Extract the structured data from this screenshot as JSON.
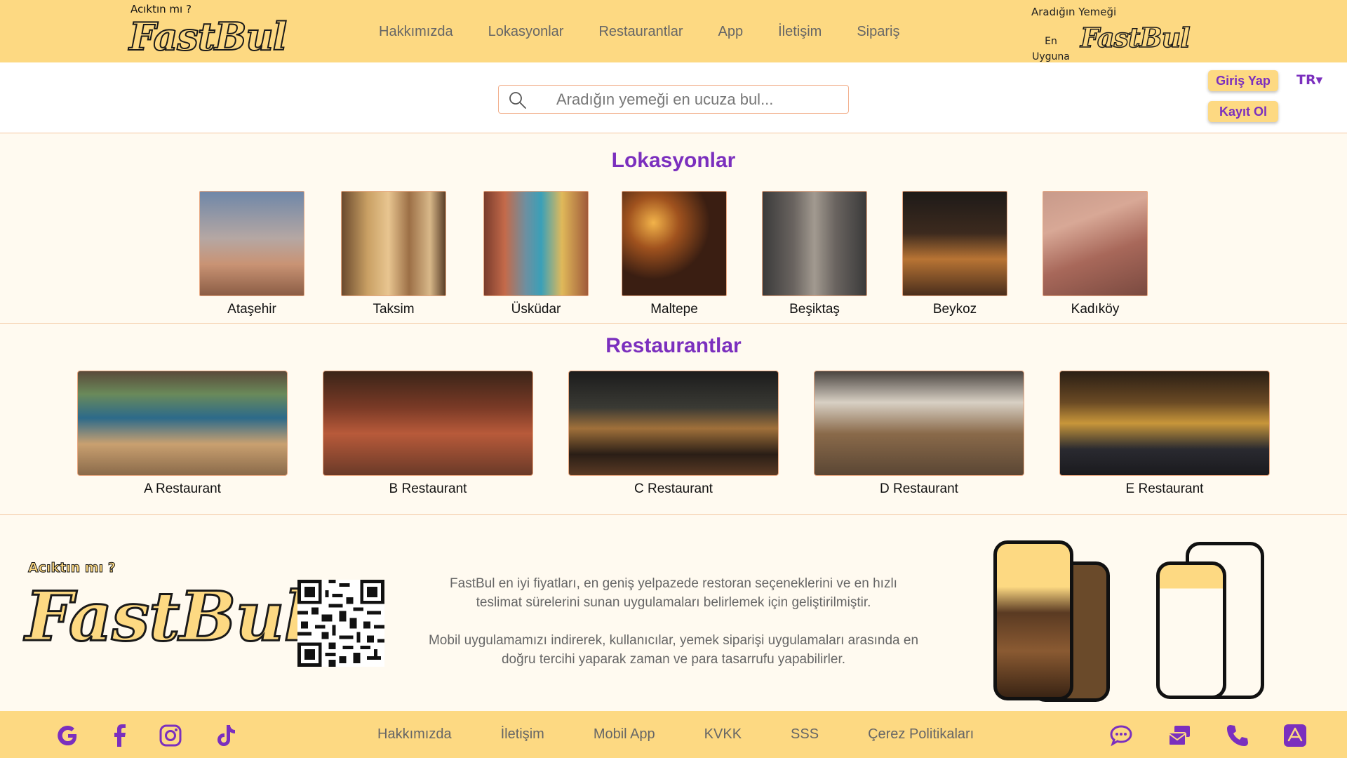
{
  "header": {
    "tagline": "Acıktın mı ?",
    "logo": "FastBul",
    "nav": [
      "Hakkımızda",
      "Lokasyonlar",
      "Restaurantlar",
      "App",
      "İletişim",
      "Sipariş"
    ],
    "slogan_top": "Aradığın Yemeği",
    "slogan_left_1": "En",
    "slogan_left_2": "Uyguna",
    "logo_small": "FastBul"
  },
  "search": {
    "placeholder": "Aradığın yemeği en ucuza bul..."
  },
  "auth": {
    "login": "Giriş Yap",
    "signup": "Kayıt Ol",
    "lang": "TR▾"
  },
  "locations": {
    "title": "Lokasyonlar",
    "items": [
      "Ataşehir",
      "Taksim",
      "Üsküdar",
      "Maltepe",
      "Beşiktaş",
      "Beykoz",
      "Kadıköy"
    ]
  },
  "restaurants": {
    "title": "Restaurantlar",
    "items": [
      "A Restaurant",
      "B Restaurant",
      "C Restaurant",
      "D Restaurant",
      "E Restaurant"
    ]
  },
  "promo": {
    "tagline": "Acıktın mı ?",
    "logo": "FastBul",
    "text1": "FastBul en iyi fiyatları, en geniş yelpazede restoran seçeneklerini ve en hızlı teslimat sürelerini sunan uygulamaları belirlemek için geliştirilmiştir.",
    "text2": "Mobil uygulamamızı indirerek, kullanıcılar, yemek siparişi uygulamaları arasında en doğru tercihi yaparak zaman ve para tasarrufu yapabilirler."
  },
  "footer": {
    "nav": [
      "Hakkımızda",
      "İletişim",
      "Mobil App",
      "KVKK",
      "SSS",
      "Çerez Politikaları"
    ]
  },
  "colors": {
    "brand_yellow": "#fdd982",
    "accent_purple": "#7b2fbe",
    "border_peach": "#f3c7a0"
  }
}
